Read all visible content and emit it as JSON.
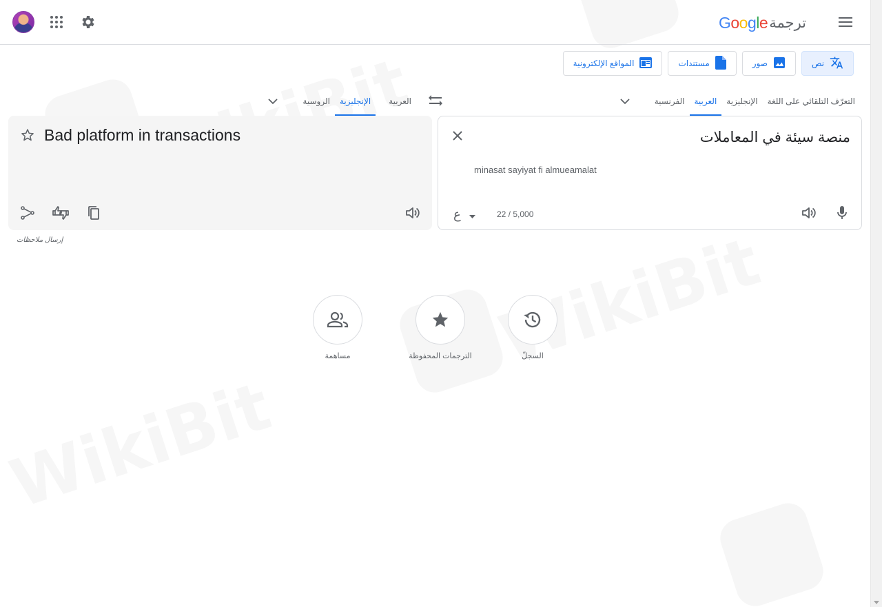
{
  "header": {
    "brand_google": "Google",
    "brand_text": "ترجمة",
    "colors": {
      "blue": "#4285F4",
      "red": "#EA4335",
      "yellow": "#FBBC05",
      "green": "#34A853"
    }
  },
  "modes": [
    {
      "label": "نص",
      "icon": "translate-icon",
      "active": true
    },
    {
      "label": "صور",
      "icon": "image-icon",
      "active": false
    },
    {
      "label": "مستندات",
      "icon": "document-icon",
      "active": false
    },
    {
      "label": "المواقع الإلكترونية",
      "icon": "website-icon",
      "active": false
    }
  ],
  "source_langs": [
    "التعرّف التلقائي على اللغة",
    "الإنجليزية",
    "العربية",
    "الفرنسية"
  ],
  "source_active": "العربية",
  "target_langs": [
    "العربية",
    "الإنجليزية",
    "الروسية"
  ],
  "target_active": "الإنجليزية",
  "source": {
    "text": "منصة سيئة في المعاملات",
    "transliteration": "minasat sayiyat fi almueamalat",
    "counter": "22 / 5,000",
    "keyboard_glyph": "ع"
  },
  "target": {
    "text": "Bad platform in transactions"
  },
  "feedback": "إرسال ملاحظات",
  "actions": [
    {
      "label": "مساهمة",
      "icon": "people-icon"
    },
    {
      "label": "الترجمات المحفوظة",
      "icon": "star-icon"
    },
    {
      "label": "السجلّ",
      "icon": "history-icon"
    }
  ],
  "watermark": "WikiBit",
  "accent": "#1a73e8"
}
